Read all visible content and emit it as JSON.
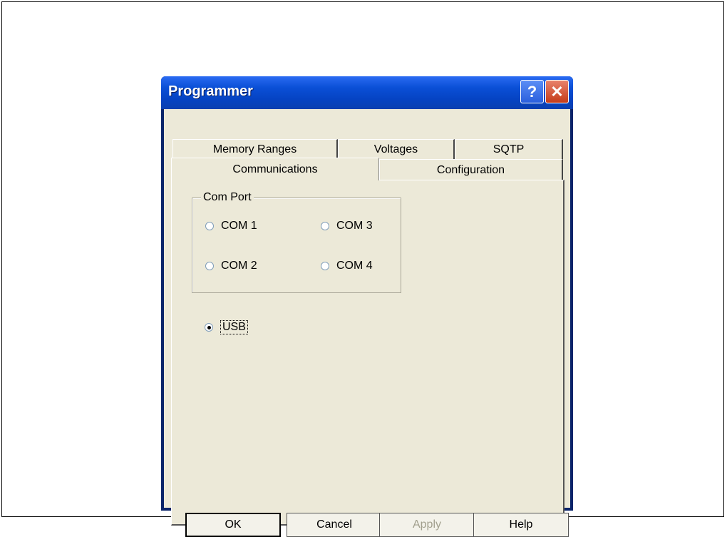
{
  "window": {
    "title": "Programmer"
  },
  "titlebar": {
    "help_glyph": "?",
    "close_glyph": "✕"
  },
  "tabs": {
    "back_row": [
      {
        "label": "Memory Ranges"
      },
      {
        "label": "Voltages"
      },
      {
        "label": "SQTP"
      }
    ],
    "front_row": [
      {
        "label": "Communications",
        "active": true
      },
      {
        "label": "Configuration",
        "active": false
      }
    ]
  },
  "com_port": {
    "label": "Com Port",
    "options": [
      {
        "label": "COM 1",
        "checked": false
      },
      {
        "label": "COM 3",
        "checked": false
      },
      {
        "label": "COM 2",
        "checked": false
      },
      {
        "label": "COM 4",
        "checked": false
      }
    ]
  },
  "usb": {
    "label": "USB",
    "checked": true
  },
  "buttons": {
    "ok": "OK",
    "cancel": "Cancel",
    "apply": "Apply",
    "help": "Help"
  },
  "colors": {
    "titlebar": "#0543c3",
    "client_bg": "#ece9d8",
    "close_button": "#c53c1a",
    "disabled_text": "#a2a08e"
  },
  "icons": {
    "help": "help-icon",
    "close": "close-icon"
  }
}
